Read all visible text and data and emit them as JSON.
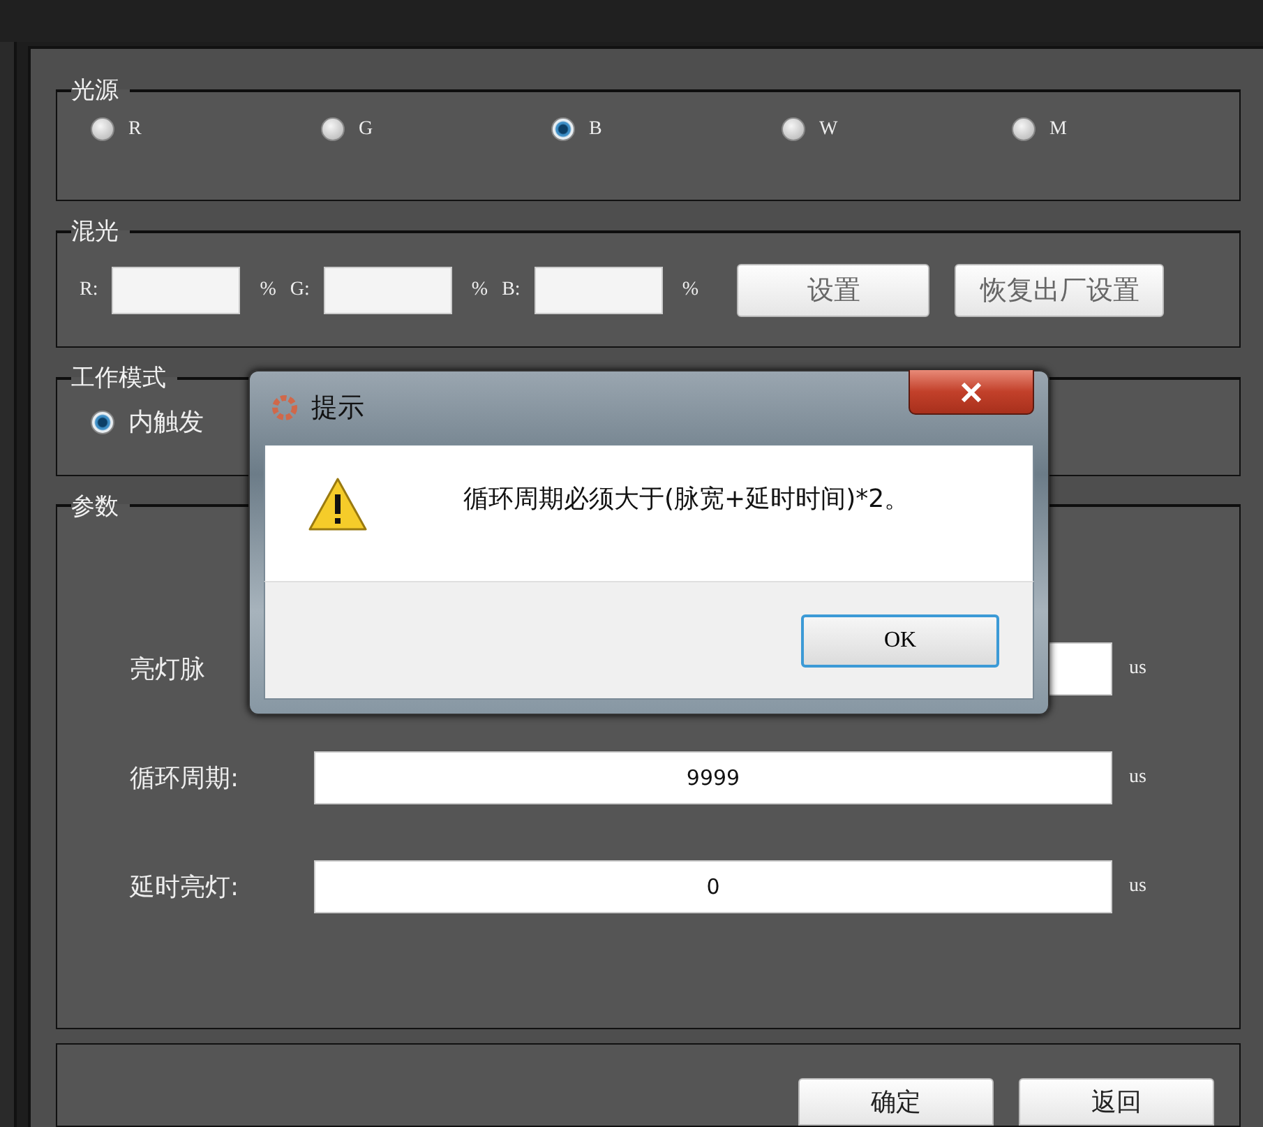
{
  "source_group": {
    "title": "光源",
    "options": [
      {
        "label": "R",
        "selected": false
      },
      {
        "label": "G",
        "selected": false
      },
      {
        "label": "B",
        "selected": true
      },
      {
        "label": "W",
        "selected": false
      },
      {
        "label": "M",
        "selected": false
      }
    ]
  },
  "mix_group": {
    "title": "混光",
    "fields": [
      {
        "label": "R:",
        "unit": "%"
      },
      {
        "label": "G:",
        "unit": "%"
      },
      {
        "label": "B:",
        "unit": "%"
      }
    ],
    "buttons": [
      "设置",
      "恢复出厂设置"
    ]
  },
  "mode_group": {
    "title": "工作模式",
    "options": [
      {
        "label": "内触发",
        "selected": true
      }
    ]
  },
  "params_group": {
    "title": "参数",
    "rows": [
      {
        "label": "亮灯脉",
        "unit": "us"
      },
      {
        "label": "循环周期:",
        "value": "9999",
        "unit": "us"
      },
      {
        "label": "延时亮灯:",
        "value": "0",
        "unit": "us"
      }
    ]
  },
  "footer_buttons": [
    "确定",
    "返回"
  ],
  "dialog": {
    "title": "提示",
    "message": "循环周期必须大于(脉宽+延时时间)*2。",
    "buttons": [
      "OK"
    ]
  }
}
